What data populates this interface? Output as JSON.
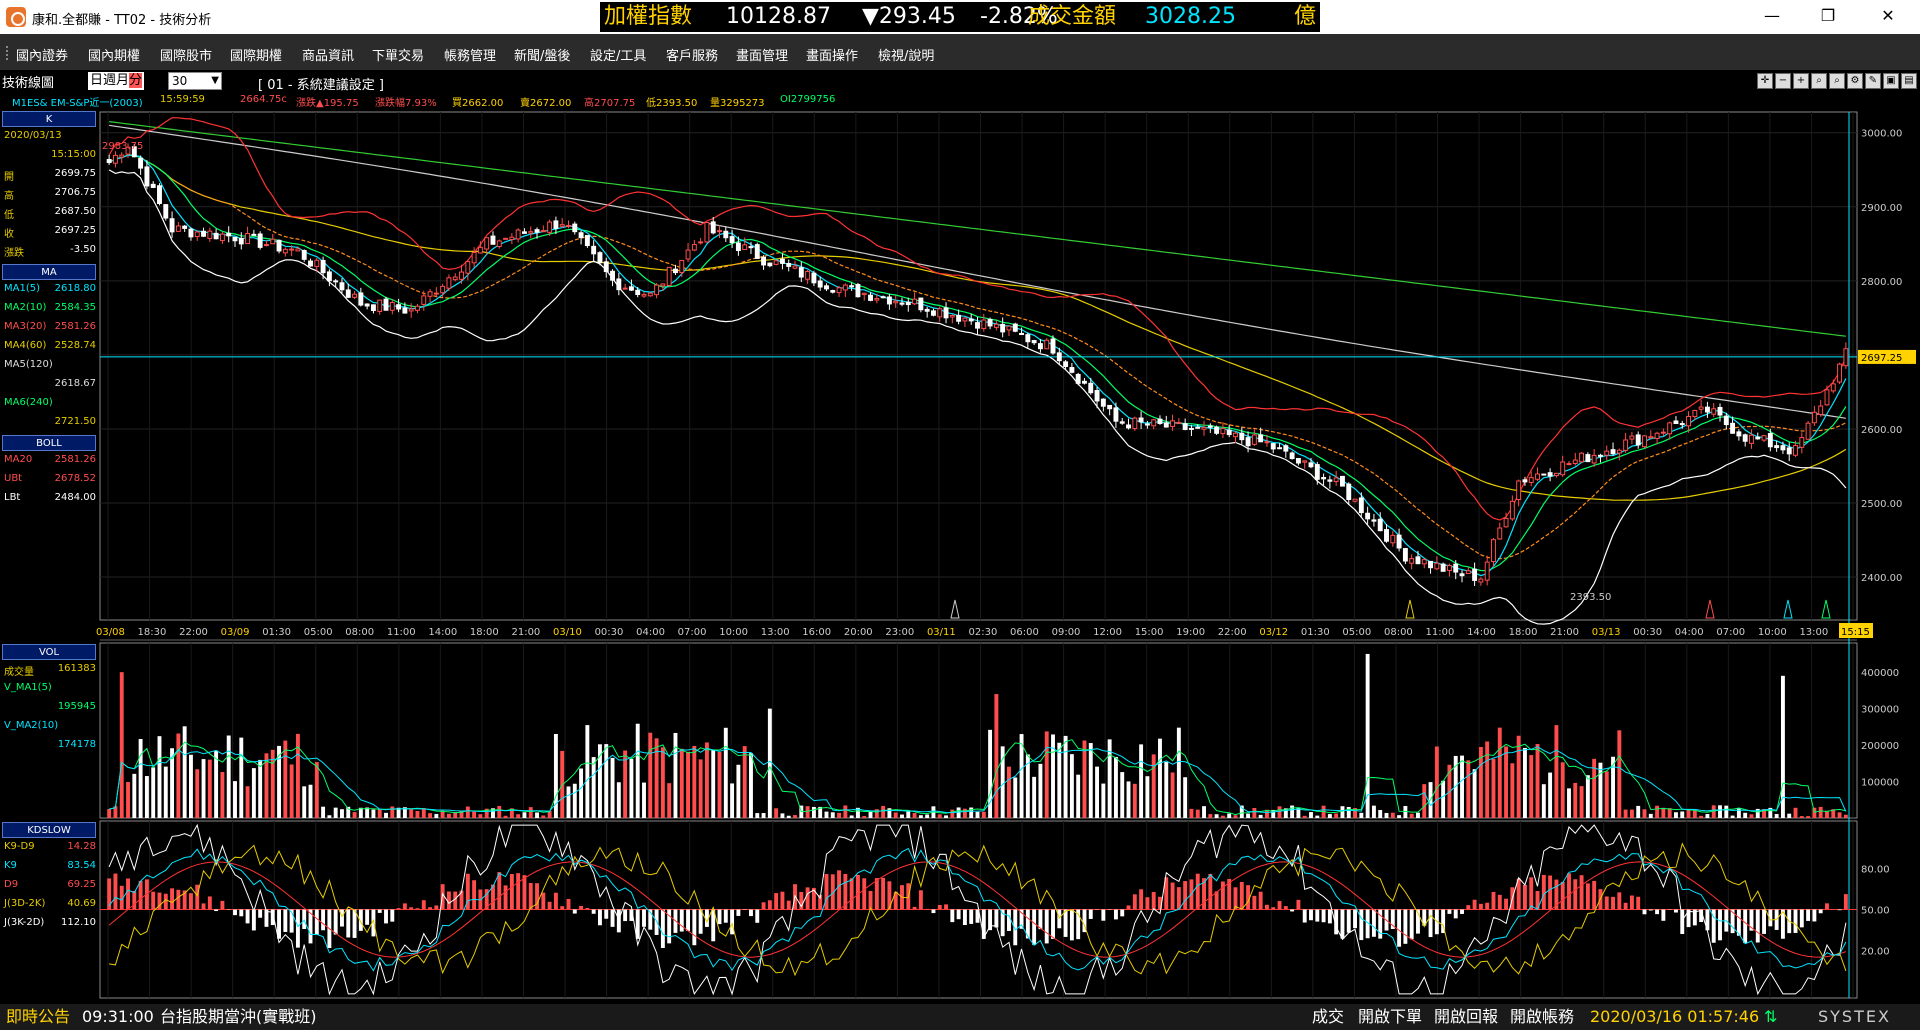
{
  "window": {
    "title": "康和.全都賺 - TT02 - 技術分析",
    "minimize": "—",
    "maximize": "❐",
    "close": "✕"
  },
  "ticker": {
    "label1": "加權指數",
    "index": "10128.87",
    "change": "▼293.45",
    "pct": "-2.82%",
    "label2": "成交金額",
    "amount": "3028.25",
    "unit": "億"
  },
  "menu": [
    "國內證券",
    "國內期權",
    "國際股市",
    "國際期權",
    "商品資訊",
    "下單交易",
    "帳務管理",
    "新聞/盤後",
    "設定/工具",
    "客戶服務",
    "畫面管理",
    "畫面操作",
    "檢視/說明"
  ],
  "toolbar": {
    "tech_label": "技術線圖",
    "periods": [
      "日",
      "週",
      "月",
      "分"
    ],
    "selected_period": "分",
    "interval": "30",
    "system_setting": "[ 01 - 系統建議設定 ]"
  },
  "info": {
    "symbol": "M1ES&  EM-S&P近一(2003)",
    "time": "15:59:59",
    "last": "2664.75c",
    "chg": "漲跌▲195.75",
    "chg_pct": "漲跌幅7.93%",
    "bid": "買2662.00",
    "ask": "賣2672.00",
    "high": "高2707.75",
    "low": "低2393.50",
    "vol": "量3295273",
    "oi": "OI2799756"
  },
  "panel": {
    "k_header": "K",
    "date": "2020/03/13",
    "time": "15:15:00",
    "open_k": "開",
    "open_v": "2699.75",
    "high_k": "高",
    "high_v": "2706.75",
    "low_k": "低",
    "low_v": "2687.50",
    "close_k": "收",
    "close_v": "2697.25",
    "chg_k": "漲跌",
    "chg_v": "-3.50",
    "ma_header": "MA",
    "ma1_k": "MA1(5)",
    "ma1_v": "2618.80",
    "ma2_k": "MA2(10)",
    "ma2_v": "2584.35",
    "ma3_k": "MA3(20)",
    "ma3_v": "2581.26",
    "ma4_k": "MA4(60)",
    "ma4_v": "2528.74",
    "ma5_k": "MA5(120)",
    "ma5_v": "2618.67",
    "ma6_k": "MA6(240)",
    "ma6_v": "2721.50",
    "boll_header": "BOLL",
    "bma_k": "MA20",
    "bma_v": "2581.26",
    "ubt_k": "UBt",
    "ubt_v": "2678.52",
    "lbt_k": "LBt",
    "lbt_v": "2484.00",
    "vol_header": "VOL",
    "vol_k": "成交量",
    "vol_v": "161383",
    "vma1_k": "V_MA1(5)",
    "vma1_v": "195945",
    "vma2_k": "V_MA2(10)",
    "vma2_v": "174178",
    "kd_header": "KDSLOW",
    "k9d9_k": "K9-D9",
    "k9d9_v": "14.28",
    "k9_k": "K9",
    "k9_v": "83.54",
    "d9_k": "D9",
    "d9_v": "69.25",
    "j1_k": "J(3D-2K)",
    "j1_v": "40.69",
    "j2_k": "J(3K-2D)",
    "j2_v": "112.10"
  },
  "axes": {
    "price_ticks": [
      "3000.00",
      "2900.00",
      "2800.00",
      "2700.00",
      "2600.00",
      "2500.00",
      "2400.00"
    ],
    "last_price_tag": "2697.25",
    "high_mark": "2983.75",
    "low_mark": "2393.50",
    "vol_ticks": [
      "400000",
      "300000",
      "200000",
      "100000"
    ],
    "kd_ticks": [
      "80.00",
      "50.00",
      "20.00"
    ],
    "time_labels": [
      {
        "t": "03/08",
        "c": "date"
      },
      {
        "t": "18:30",
        "c": "t"
      },
      {
        "t": "22:00",
        "c": "t"
      },
      {
        "t": "03/09",
        "c": "date"
      },
      {
        "t": "01:30",
        "c": "t"
      },
      {
        "t": "05:00",
        "c": "t"
      },
      {
        "t": "08:00",
        "c": "t"
      },
      {
        "t": "11:00",
        "c": "t"
      },
      {
        "t": "14:00",
        "c": "t"
      },
      {
        "t": "18:00",
        "c": "t"
      },
      {
        "t": "21:00",
        "c": "t"
      },
      {
        "t": "03/10",
        "c": "date"
      },
      {
        "t": "00:30",
        "c": "t"
      },
      {
        "t": "04:00",
        "c": "t"
      },
      {
        "t": "07:00",
        "c": "t"
      },
      {
        "t": "10:00",
        "c": "t"
      },
      {
        "t": "13:00",
        "c": "t"
      },
      {
        "t": "16:00",
        "c": "t"
      },
      {
        "t": "20:00",
        "c": "t"
      },
      {
        "t": "23:00",
        "c": "t"
      },
      {
        "t": "03/11",
        "c": "date"
      },
      {
        "t": "02:30",
        "c": "t"
      },
      {
        "t": "06:00",
        "c": "t"
      },
      {
        "t": "09:00",
        "c": "t"
      },
      {
        "t": "12:00",
        "c": "t"
      },
      {
        "t": "15:00",
        "c": "t"
      },
      {
        "t": "19:00",
        "c": "t"
      },
      {
        "t": "22:00",
        "c": "t"
      },
      {
        "t": "03/12",
        "c": "date"
      },
      {
        "t": "01:30",
        "c": "t"
      },
      {
        "t": "05:00",
        "c": "t"
      },
      {
        "t": "08:00",
        "c": "t"
      },
      {
        "t": "11:00",
        "c": "t"
      },
      {
        "t": "14:00",
        "c": "t"
      },
      {
        "t": "18:00",
        "c": "t"
      },
      {
        "t": "21:00",
        "c": "t"
      },
      {
        "t": "03/13",
        "c": "date"
      },
      {
        "t": "00:30",
        "c": "t"
      },
      {
        "t": "04:00",
        "c": "t"
      },
      {
        "t": "07:00",
        "c": "t"
      },
      {
        "t": "10:00",
        "c": "t"
      },
      {
        "t": "13:00",
        "c": "t"
      },
      {
        "t": "15:15",
        "c": "cur"
      }
    ]
  },
  "colors": {
    "up": "#ff4d4d",
    "down": "#ffffff",
    "ma5": "#00e5ff",
    "ma10": "#00ff66",
    "ma20": "#ff8c1a",
    "ma60": "#e6cc00",
    "ma120": "#cccccc",
    "ma240": "#33cc33",
    "boll_up": "#ff3333",
    "boll_low": "#ffffff"
  },
  "status": {
    "announce": "即時公告",
    "time": "09:31:00",
    "msg": "台指股期當沖(實戰班)",
    "trade": "成交",
    "open_order": "開啟下單",
    "open_report": "開啟回報",
    "open_account": "開啟帳務",
    "datetime": "2020/03/16 01:57:46",
    "brand": "SYSTEX"
  }
}
